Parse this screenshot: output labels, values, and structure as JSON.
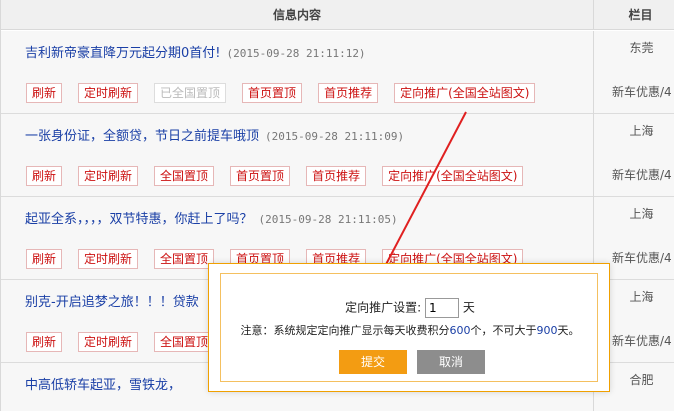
{
  "header": {
    "content": "信息内容",
    "column": "栏目"
  },
  "rows": [
    {
      "title": "吉利新帝豪直降万元起分期0首付!",
      "time": "(2015-09-28 21:11:12)",
      "city": "东莞",
      "category": "新车优惠/4",
      "buttons": [
        "刷新",
        "定时刷新",
        "已全国置顶",
        "首页置顶",
        "首页推荐",
        "定向推广(全国全站图文)"
      ]
    },
    {
      "title": "一张身份证，全额贷，节日之前提车哦顶",
      "time": "(2015-09-28 21:11:09)",
      "city": "上海",
      "category": "新车优惠/4",
      "buttons": [
        "刷新",
        "定时刷新",
        "全国置顶",
        "首页置顶",
        "首页推荐",
        "定向推广(全国全站图文)"
      ]
    },
    {
      "title": "起亚全系，，，，双节特惠，你赶上了吗？",
      "time": "(2015-09-28 21:11:05)",
      "city": "上海",
      "category": "新车优惠/4",
      "buttons": [
        "刷新",
        "定时刷新",
        "全国置顶",
        "首页置顶",
        "首页推荐",
        "定向推广(全国全站图文)"
      ]
    },
    {
      "title": "别克-开启追梦之旅！！！贷款",
      "time": "",
      "city": "上海",
      "category": "新车优惠/4",
      "buttons": [
        "刷新",
        "定时刷新",
        "全国置顶"
      ]
    },
    {
      "title": "中高低轿车起亚，雪铁龙，",
      "time": "",
      "city": "合肥",
      "category": "",
      "buttons": []
    }
  ],
  "dialog": {
    "setting_label": "定向推广设置:",
    "days_value": "1",
    "days_unit": "天",
    "note_prefix": "注意：系统规定定向推广显示每天收费积分",
    "note_points": "600",
    "note_middle": "个，不可大于",
    "note_max": "900",
    "note_suffix": "天。",
    "submit_label": "提交",
    "cancel_label": "取消"
  },
  "colors": {
    "title_link": "#1a3fa6",
    "button_text": "#cc1111",
    "submit_bg": "#f39c12",
    "cancel_bg": "#8d8d8d",
    "dialog_border": "#f0a000",
    "arrow": "#e02020"
  }
}
